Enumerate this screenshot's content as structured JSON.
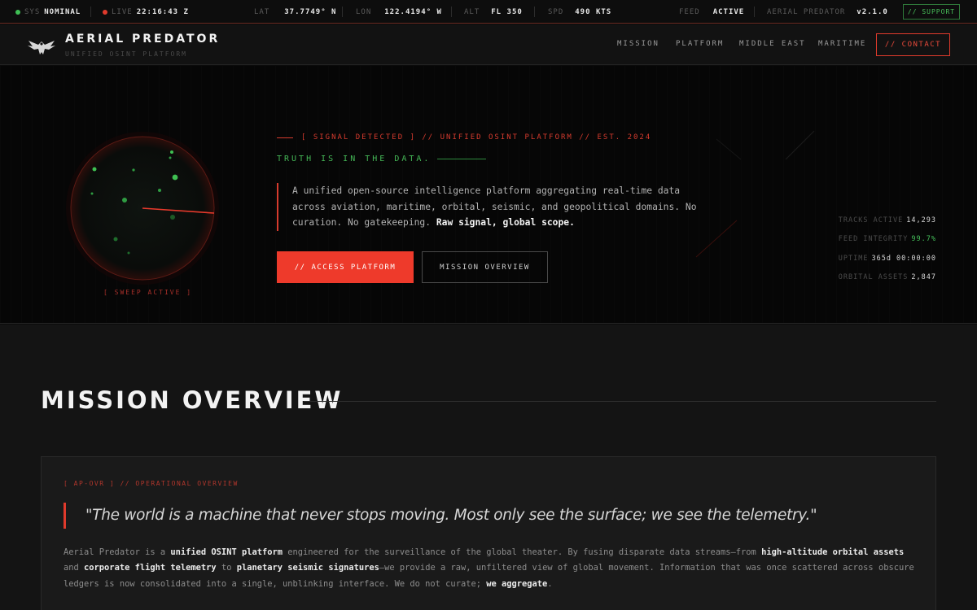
{
  "status_bar": {
    "sys_label": "SYS",
    "sys_value": "NOMINAL",
    "live_label": "LIVE",
    "live_value": "22:16:43 Z",
    "lat_label": "LAT",
    "lat_value": "37.7749° N",
    "lon_label": "LON",
    "lon_value": "122.4194° W",
    "alt_label": "ALT",
    "alt_value": "FL 350",
    "spd_label": "SPD",
    "spd_value": "490 KTS",
    "feed_label": "FEED",
    "feed_value": "ACTIVE",
    "app_label": "AERIAL PREDATOR",
    "version": "v2.1.0",
    "support_label": "// SUPPORT",
    "colors": {
      "ok": "#3fbf55",
      "live": "#e03a2c"
    }
  },
  "nav": {
    "brand": "AERIAL PREDATOR",
    "subtitle": "UNIFIED OSINT PLATFORM",
    "links": [
      "MISSION",
      "PLATFORM",
      "MIDDLE EAST",
      "MARITIME"
    ],
    "contact_label": "// CONTACT"
  },
  "hero": {
    "sweep_label": "[ SWEEP ACTIVE ]",
    "eyebrow": "[ SIGNAL DETECTED ] // UNIFIED OSINT PLATFORM // EST. 2024",
    "tagline": "TRUTH IS IN THE DATA.",
    "description": "A unified open-source intelligence platform aggregating real-time data across aviation, maritime, orbital, seismic, and geopolitical domains. No curation. No gatekeeping.",
    "description_bold": "Raw signal, global scope.",
    "primary_cta": "// ACCESS PLATFORM",
    "secondary_cta": "MISSION OVERVIEW",
    "stats": [
      {
        "label": "TRACKS ACTIVE",
        "value": "14,293"
      },
      {
        "label": "FEED INTEGRITY",
        "value": "99.7%"
      },
      {
        "label": "UPTIME",
        "value": "365d 00:00:00"
      },
      {
        "label": "ORBITAL ASSETS",
        "value": "2,847"
      }
    ],
    "colors": {
      "accent": "#ee3a2b",
      "signal": "#45b857"
    }
  },
  "mission": {
    "title": "MISSION OVERVIEW",
    "card_tag": "[ AP-OVR ] // OPERATIONAL OVERVIEW",
    "quote": "\"The world is a machine that never stops moving. Most only see the surface; we see the telemetry.\"",
    "body": [
      {
        "t": "Aerial Predator is a ",
        "b": false
      },
      {
        "t": "unified OSINT platform",
        "b": true
      },
      {
        "t": " engineered for the surveillance of the global theater. By fusing disparate data streams—from ",
        "b": false
      },
      {
        "t": "high-altitude orbital assets",
        "b": true
      },
      {
        "t": " and ",
        "b": false
      },
      {
        "t": "corporate flight telemetry",
        "b": true
      },
      {
        "t": " to ",
        "b": false
      },
      {
        "t": "planetary seismic signatures",
        "b": true
      },
      {
        "t": "—we provide a raw, unfiltered view of global movement. Information that was once scattered across obscure ledgers is now consolidated into a single, unblinking interface. We do not curate; ",
        "b": false
      },
      {
        "t": "we aggregate",
        "b": true
      },
      {
        "t": ".",
        "b": false
      }
    ]
  }
}
